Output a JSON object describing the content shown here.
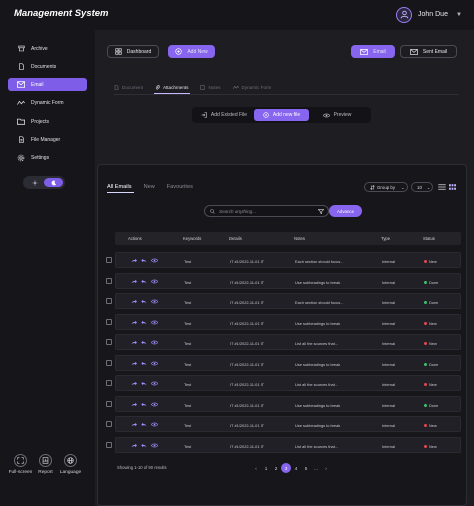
{
  "app": {
    "title": "Management System"
  },
  "user": {
    "name": "John Due"
  },
  "sidebar": {
    "items": [
      {
        "label": "Archive",
        "icon": "archive-icon"
      },
      {
        "label": "Documents",
        "icon": "document-icon"
      },
      {
        "label": "Email",
        "icon": "mail-icon",
        "active": true
      },
      {
        "label": "Dynamic Form",
        "icon": "wave-icon"
      },
      {
        "label": "Projects",
        "icon": "folder-icon"
      },
      {
        "label": "File Manager",
        "icon": "file-icon"
      },
      {
        "label": "Settings",
        "icon": "gear-icon"
      }
    ],
    "theme": {
      "light_icon": "sun-icon",
      "dark_icon": "moon-icon",
      "selected": "dark"
    },
    "tools": [
      {
        "label": "Full-screen",
        "icon": "fullscreen-icon"
      },
      {
        "label": "Report",
        "icon": "report-icon"
      },
      {
        "label": "Language",
        "icon": "globe-icon"
      }
    ]
  },
  "toolbar": {
    "dashboard": "Dashboard",
    "add_new": "Add New",
    "email": "Email",
    "sent_email": "Sent Email"
  },
  "section_tabs": [
    {
      "label": "Document",
      "icon": "document-icon"
    },
    {
      "label": "Attachments",
      "icon": "attachment-icon",
      "active": true
    },
    {
      "label": "Notes",
      "icon": "note-icon"
    },
    {
      "label": "Dynamic Form",
      "icon": "wave-icon"
    }
  ],
  "file_options": {
    "existing": "Add Existed File",
    "new_file": "Add new file",
    "preview": "Preview"
  },
  "list": {
    "tabs": [
      "All Emails",
      "New",
      "Favourites"
    ],
    "group_by": "Group by",
    "per_page": "10",
    "search_placeholder": "Search anything...",
    "advance": "Advance",
    "columns": [
      "Actions",
      "Keywords",
      "Details",
      "Notes",
      "Type",
      "Status"
    ],
    "rows": [
      {
        "keywords": "Test",
        "details": "IT #1/2022-11-01 IT",
        "notes": "Each section should focus...",
        "type": "Internal",
        "status": "New"
      },
      {
        "keywords": "Test",
        "details": "IT #1/2022-11-01 IT",
        "notes": "Use subheadings to break",
        "type": "Internal",
        "status": "Done"
      },
      {
        "keywords": "Test",
        "details": "IT #1/2022-11-01 IT",
        "notes": "Each section should focus...",
        "type": "Internal",
        "status": "Done"
      },
      {
        "keywords": "Test",
        "details": "IT #1/2022-11-01 IT",
        "notes": "Use subheadings to break",
        "type": "Internal",
        "status": "New"
      },
      {
        "keywords": "Test",
        "details": "IT #1/2022-11-01 IT",
        "notes": "List all the sources that...",
        "type": "Internal",
        "status": "New"
      },
      {
        "keywords": "Test",
        "details": "IT #1/2022-11-01 IT",
        "notes": "Use subheadings to break",
        "type": "Internal",
        "status": "Done"
      },
      {
        "keywords": "Test",
        "details": "IT #1/2022-11-01 IT",
        "notes": "List all the sources that...",
        "type": "Internal",
        "status": "New"
      },
      {
        "keywords": "Test",
        "details": "IT #1/2022-11-01 IT",
        "notes": "Use subheadings to break",
        "type": "Internal",
        "status": "Done"
      },
      {
        "keywords": "Test",
        "details": "IT #1/2022-11-01 IT",
        "notes": "Use subheadings to break",
        "type": "Internal",
        "status": "New"
      },
      {
        "keywords": "Test",
        "details": "IT #1/2022-11-01 IT",
        "notes": "List all the sources that...",
        "type": "Internal",
        "status": "New"
      }
    ],
    "summary": "Showing 1-10 of 90 results",
    "pages": [
      "1",
      "2",
      "3",
      "4",
      "5",
      "..."
    ],
    "current_page": "3"
  },
  "colors": {
    "accent": "#8765ee",
    "status_new": "#e5484d",
    "status_done": "#3fbf6a"
  }
}
